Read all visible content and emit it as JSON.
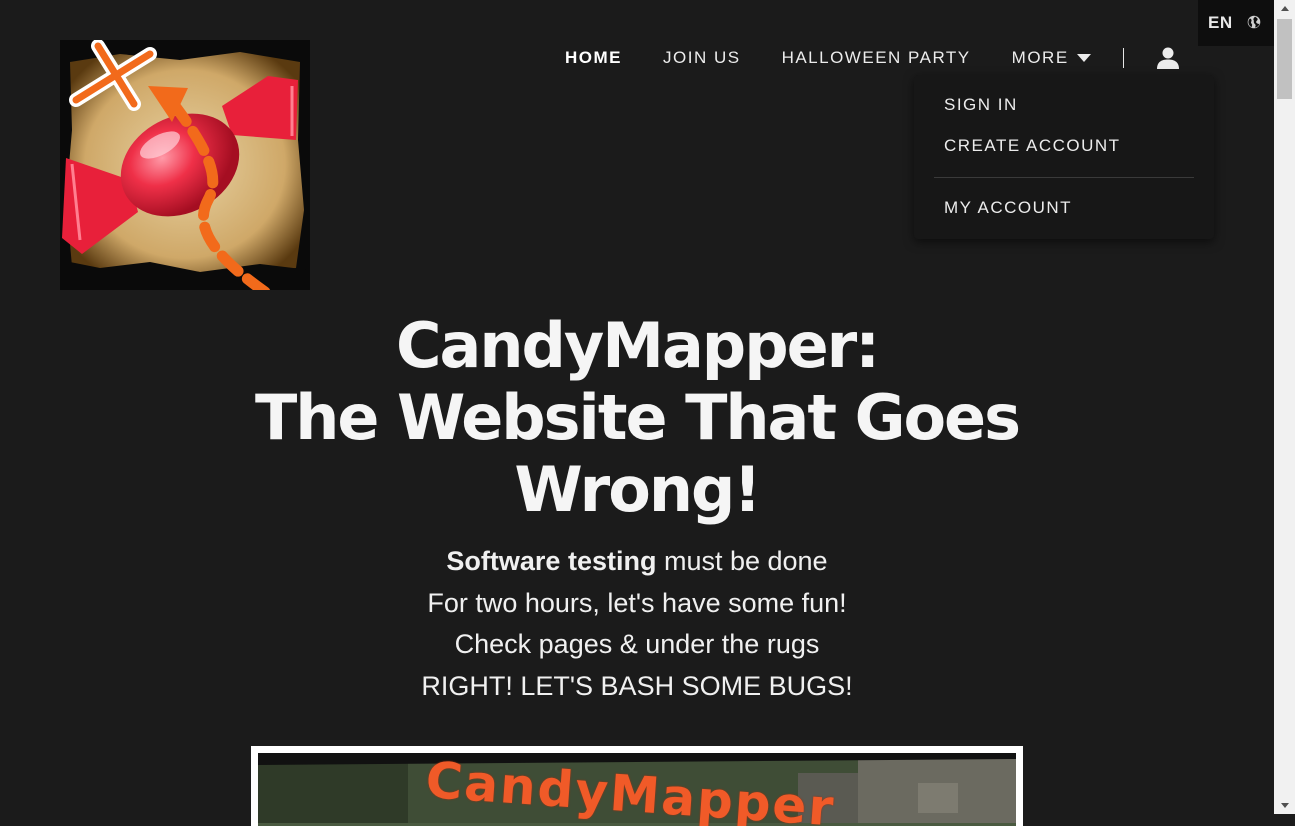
{
  "language": {
    "code": "EN",
    "icon": "globe-icon"
  },
  "logo": {
    "alt": "CandyMapper logo",
    "icon": "candy-map-logo"
  },
  "nav": {
    "items": [
      {
        "label": "HOME",
        "active": true
      },
      {
        "label": "JOIN US",
        "active": false
      },
      {
        "label": "HALLOWEEN PARTY",
        "active": false
      }
    ],
    "more_label": "MORE",
    "account_icon": "user-icon"
  },
  "dropdown": {
    "items": [
      {
        "label": "SIGN IN"
      },
      {
        "label": "CREATE ACCOUNT"
      },
      {
        "label": "MY ACCOUNT"
      }
    ]
  },
  "hero": {
    "title_line1": "CandyMapper:",
    "title_line2": "The Website That Goes",
    "title_line3": "Wrong!",
    "line1_bold": "Software testing",
    "line1_rest": " must be done",
    "line2": "For two hours, let's have some fun!",
    "line3": "Check pages & under the rugs",
    "line4": "RIGHT! LET'S BASH SOME BUGS!"
  },
  "banner": {
    "text": "CandyMapper"
  },
  "colors": {
    "background": "#1b1b1b",
    "accent": "#f26a1b",
    "candy": "#e8203a",
    "text": "#f0f0f0"
  }
}
